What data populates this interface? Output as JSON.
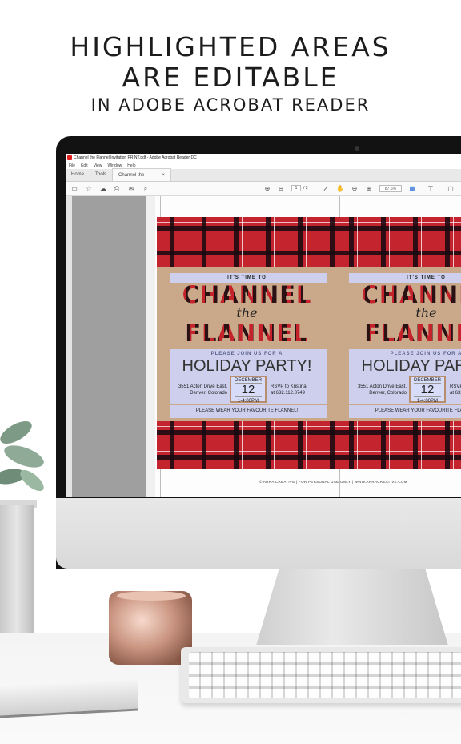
{
  "headline": {
    "line1": "HIGHLIGHTED AREAS",
    "line2": "ARE EDITABLE",
    "line3": "IN ADOBE ACROBAT READER"
  },
  "window": {
    "title": "Channel the Flannel Invitation PRINT.pdf - Adobe Acrobat Reader DC",
    "menu": [
      "File",
      "Edit",
      "View",
      "Window",
      "Help"
    ],
    "tabs": {
      "home": "Home",
      "tools": "Tools",
      "document": "Channel the Flanne...",
      "close": "×"
    },
    "page_current": "1",
    "page_total": "/ 2",
    "zoom": "87.6%"
  },
  "invitation": {
    "its_time": "IT'S TIME TO",
    "channel": "CHANNEL",
    "the": "the",
    "flannel": "FLANNEL",
    "join": "PLEASE JOIN US FOR A",
    "party": "HOLIDAY PARTY!",
    "address1": "3551 Acton Drive East,",
    "address2": "Denver, Colorado",
    "month": "DECEMBER",
    "day": "12",
    "time": "1-4:00PM",
    "rsvp1": "RSVP to Kristina",
    "rsvp2": "at 632.112.8749",
    "wear": "PLEASE WEAR YOUR FAVOURITE FLANNEL!"
  },
  "footer": "© ARRA CREATIVE  |  FOR PERSONAL USE ONLY  |  WWW.ARRACREATIVE.COM",
  "colors": {
    "plaid_red": "#c4242e",
    "kraft": "#caa98a",
    "highlight": "#cdd2f5"
  }
}
